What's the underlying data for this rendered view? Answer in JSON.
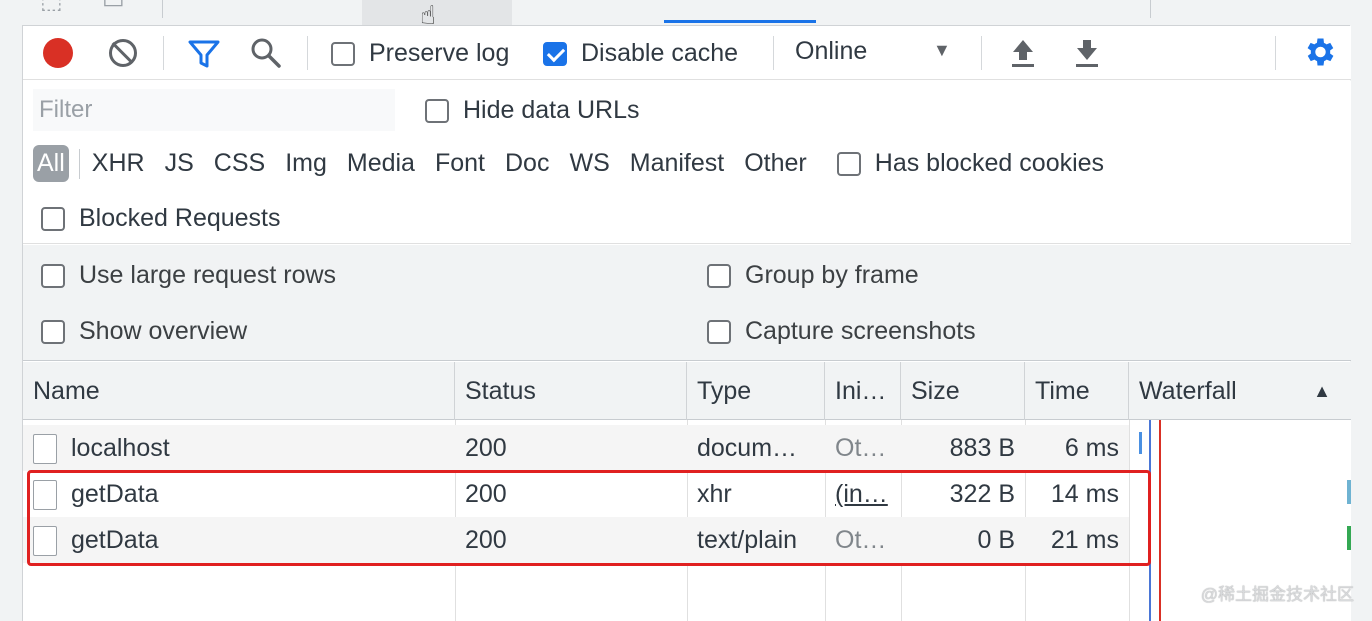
{
  "toolbar": {
    "preserve_log_label": "Preserve log",
    "preserve_log_checked": false,
    "disable_cache_label": "Disable cache",
    "disable_cache_checked": true,
    "throttling_value": "Online"
  },
  "filter": {
    "placeholder": "Filter",
    "hide_data_urls_label": "Hide data URLs",
    "types": [
      "All",
      "XHR",
      "JS",
      "CSS",
      "Img",
      "Media",
      "Font",
      "Doc",
      "WS",
      "Manifest",
      "Other"
    ],
    "active_type": "All",
    "has_blocked_cookies_label": "Has blocked cookies",
    "blocked_requests_label": "Blocked Requests"
  },
  "settings": {
    "large_rows_label": "Use large request rows",
    "show_overview_label": "Show overview",
    "group_by_frame_label": "Group by frame",
    "capture_screenshots_label": "Capture screenshots"
  },
  "table": {
    "columns": [
      "Name",
      "Status",
      "Type",
      "Ini…",
      "Size",
      "Time",
      "Waterfall"
    ],
    "rows": [
      {
        "name": "localhost",
        "status": "200",
        "type": "docum…",
        "initiator": "Ot…",
        "size": "883 B",
        "time": "6 ms"
      },
      {
        "name": "getData",
        "status": "200",
        "type": "xhr",
        "initiator": "(in…",
        "size": "322 B",
        "time": "14 ms"
      },
      {
        "name": "getData",
        "status": "200",
        "type": "text/plain",
        "initiator": "Ot…",
        "size": "0 B",
        "time": "21 ms"
      }
    ]
  },
  "watermark": "@稀土掘金技术社区",
  "colors": {
    "accent": "#1a73e8",
    "record": "#d93025",
    "highlight": "#e02020"
  }
}
